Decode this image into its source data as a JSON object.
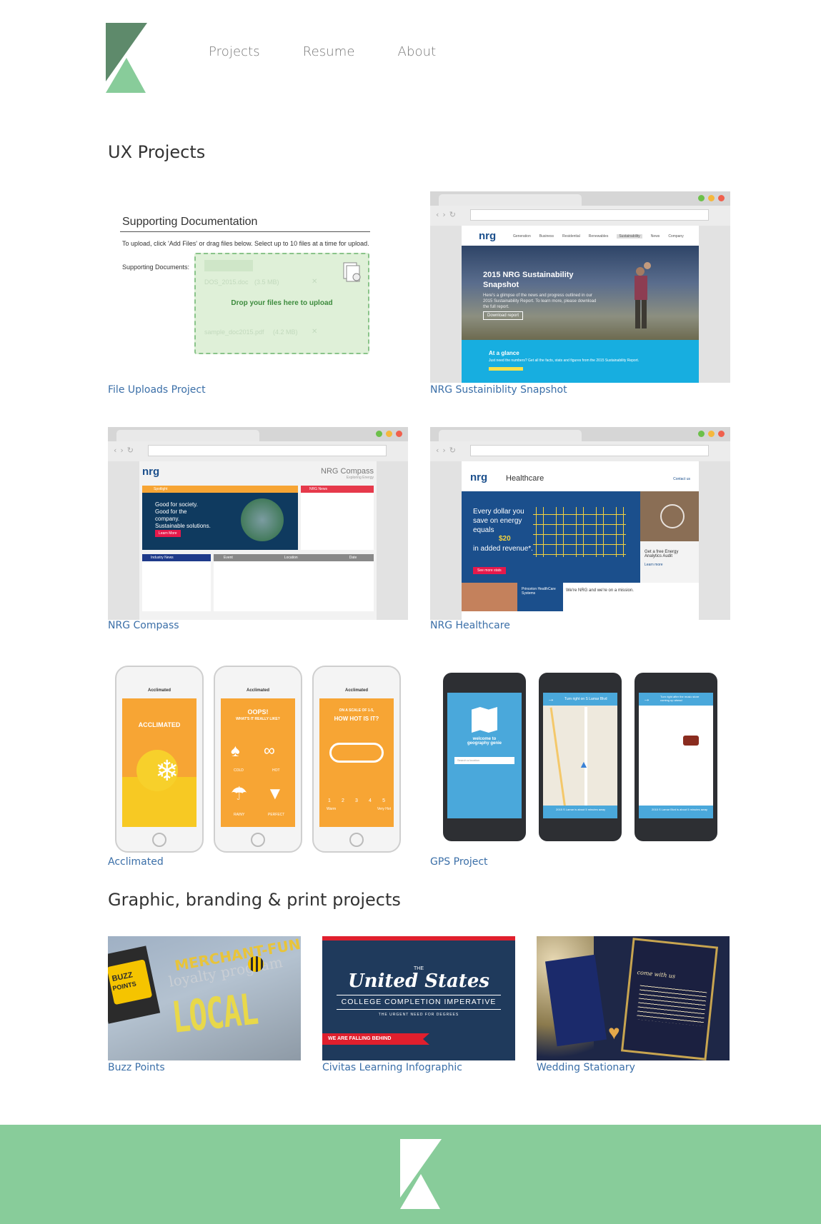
{
  "brand": {
    "logo_icon": "k-logo-icon"
  },
  "nav": [
    {
      "label": "Projects"
    },
    {
      "label": "Resume"
    },
    {
      "label": "About"
    }
  ],
  "sections": {
    "ux_title": "UX Projects",
    "graphic_title": "Graphic, branding & print projects"
  },
  "ux_projects": [
    {
      "caption": "File Uploads Project"
    },
    {
      "caption": "NRG Sustainiblity Snapshot"
    },
    {
      "caption": "NRG Compass"
    },
    {
      "caption": "NRG Healthcare"
    },
    {
      "caption": "Acclimated"
    },
    {
      "caption": "GPS Project"
    }
  ],
  "graphic_projects": [
    {
      "caption": "Buzz Points"
    },
    {
      "caption": "Civitas Learning Infographic"
    },
    {
      "caption": "Wedding Stationary"
    }
  ],
  "thumbs": {
    "uploads": {
      "heading": "Supporting Documentation",
      "instructions": "To upload, click 'Add Files' or drag files below. Select up to 10 files at a time for upload.",
      "field_label": "Supporting Documents:",
      "drop_text": "Drop your files here to upload",
      "file1": "DOS_2015.doc",
      "file1_size": "(3.5 MB)",
      "file2": "sample_doc2015.pdf",
      "file2_size": "(4.2 MB)"
    },
    "snapshot": {
      "logo": "nrg",
      "menu": [
        "Generation",
        "Business",
        "Residential",
        "Renewables",
        "Sustainability",
        "News",
        "Company"
      ],
      "title": "2015 NRG Sustainability Snapshot",
      "body": "Here's a glimpse of the news and progress outlined in our 2015 Sustainability Report. To learn more, please download the full report.",
      "button": "Download report",
      "glance_title": "At a glance",
      "glance_body": "Just need the numbers? Get all the facts, stats and figures from the 2015 Sustainability Report."
    },
    "compass": {
      "logo": "nrg",
      "title": "NRG Compass",
      "subtitle": "Exploring Energy",
      "spotlight": "Spotlight",
      "headline": "Good for society. Good for the company. Sustainable solutions.",
      "learn": "Learn More",
      "news": "NRG News",
      "industry": "Industry News",
      "cols": [
        "Event",
        "Location",
        "Date"
      ]
    },
    "healthcare": {
      "logo": "nrg",
      "title": "Healthcare",
      "contact": "Contact us",
      "headline_a": "Every dollar you save on energy equals",
      "headline_amount": "$20",
      "headline_b": "in added revenue*.",
      "button": "See more stats",
      "side": "Get a free Energy Analytics Audit",
      "learn": "Learn more",
      "princeton": "Princeton HealthCare Systems",
      "mission": "We're NRG and we're on a mission."
    },
    "acclimated": {
      "app": "Acclimated",
      "s1": "ACCLIMATED",
      "s2a": "OOPS!",
      "s2b": "WHAT'S IT REALLY LIKE?",
      "s3a": "ON A SCALE OF 1-5,",
      "s3b": "HOW HOT IS IT?",
      "opt1": "COLD",
      "opt2": "HOT",
      "opt3": "RAINY",
      "opt4": "PERFECT",
      "scale": [
        "1",
        "2",
        "3",
        "4",
        "5"
      ],
      "warm": "Warm",
      "very_hot": "Very Hot"
    },
    "gps": {
      "welcome": "welcome to geography genie",
      "search": "Search a location",
      "turn1": "Turn right on S Lamar Blvd",
      "turn2": "Turn right after the music store coming up ahead",
      "bottom1": "2015 S Lamar is about 5 minutes away",
      "bottom2": "2015 S Lamar Blvd is about 5 minutes away"
    },
    "buzz": {
      "logo_a": "BUZZ",
      "logo_b": "POINTS",
      "line1": "MERCHANT-FUNDED",
      "line2": "loyalty program",
      "line3": "LOCAL"
    },
    "civitas": {
      "the": "THE",
      "title": "United States",
      "sub": "COLLEGE COMPLETION IMPERATIVE",
      "sub2": "THE URGENT NEED FOR DEGREES",
      "banner": "WE ARE FALLING BEHIND"
    },
    "wedding": {
      "text": "come with us"
    }
  },
  "colors": {
    "brand_green_dark": "#5e8a6b",
    "brand_green_light": "#88cc9a",
    "link_blue": "#3b6fa8",
    "nrg_blue": "#1b4f8c",
    "nrg_cyan": "#17aee0",
    "acclimated_orange": "#f7a534",
    "gps_blue": "#4aa8db"
  }
}
